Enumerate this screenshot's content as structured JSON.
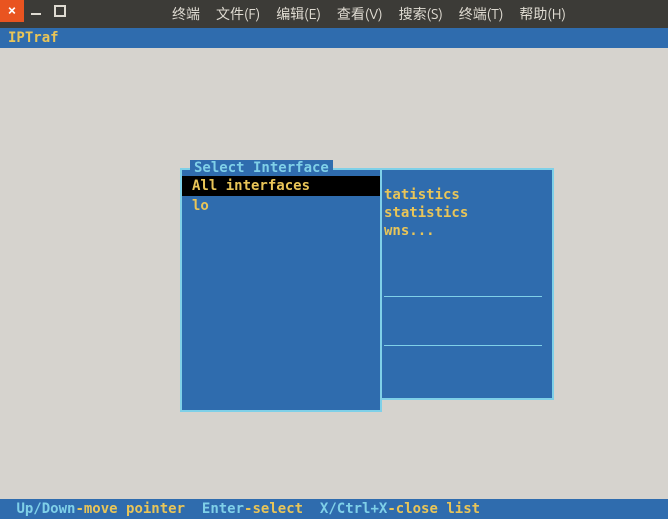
{
  "window": {
    "menu": {
      "terminal": "终端",
      "file": "文件(F)",
      "edit": "编辑(E)",
      "view": "查看(V)",
      "search": "搜索(S)",
      "terminal2": "终端(T)",
      "help": "帮助(H)"
    }
  },
  "app": {
    "title": "IPTraf"
  },
  "back_panel": {
    "line1": "tatistics",
    "line2": "statistics",
    "line3": "wns..."
  },
  "select_box": {
    "title": "Select Interface",
    "items": [
      {
        "label": "All interfaces",
        "selected": true
      },
      {
        "label": "lo",
        "selected": false
      }
    ]
  },
  "status": {
    "k1": "Up/Down",
    "t1": "-move pointer  ",
    "k2": "Enter",
    "t2": "-select  ",
    "k3": "X/Ctrl+X",
    "t3": "-close list"
  }
}
